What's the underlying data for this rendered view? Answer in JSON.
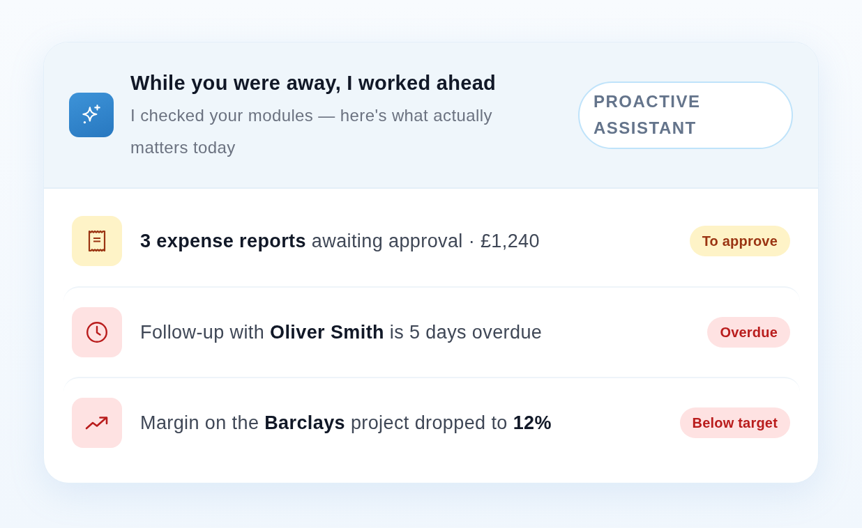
{
  "header": {
    "title": "While you were away, I worked ahead",
    "subtitle": "I checked your modules — here's what actually matters today",
    "label": "PROACTIVE ASSISTANT"
  },
  "items": [
    {
      "kind": "receipt",
      "color": "#9a3412",
      "text": "**3 expense reports** awaiting approval · £1,240",
      "status": "To approve"
    },
    {
      "kind": "clock",
      "color": "#b91c1c",
      "text": "Follow-up with **Oliver Smith** is 5 days overdue",
      "status": "Overdue"
    },
    {
      "kind": "trend",
      "color": "#b91c1c",
      "text": "Margin on the **Barclays** project dropped to **12%**",
      "status": "Below target"
    }
  ]
}
